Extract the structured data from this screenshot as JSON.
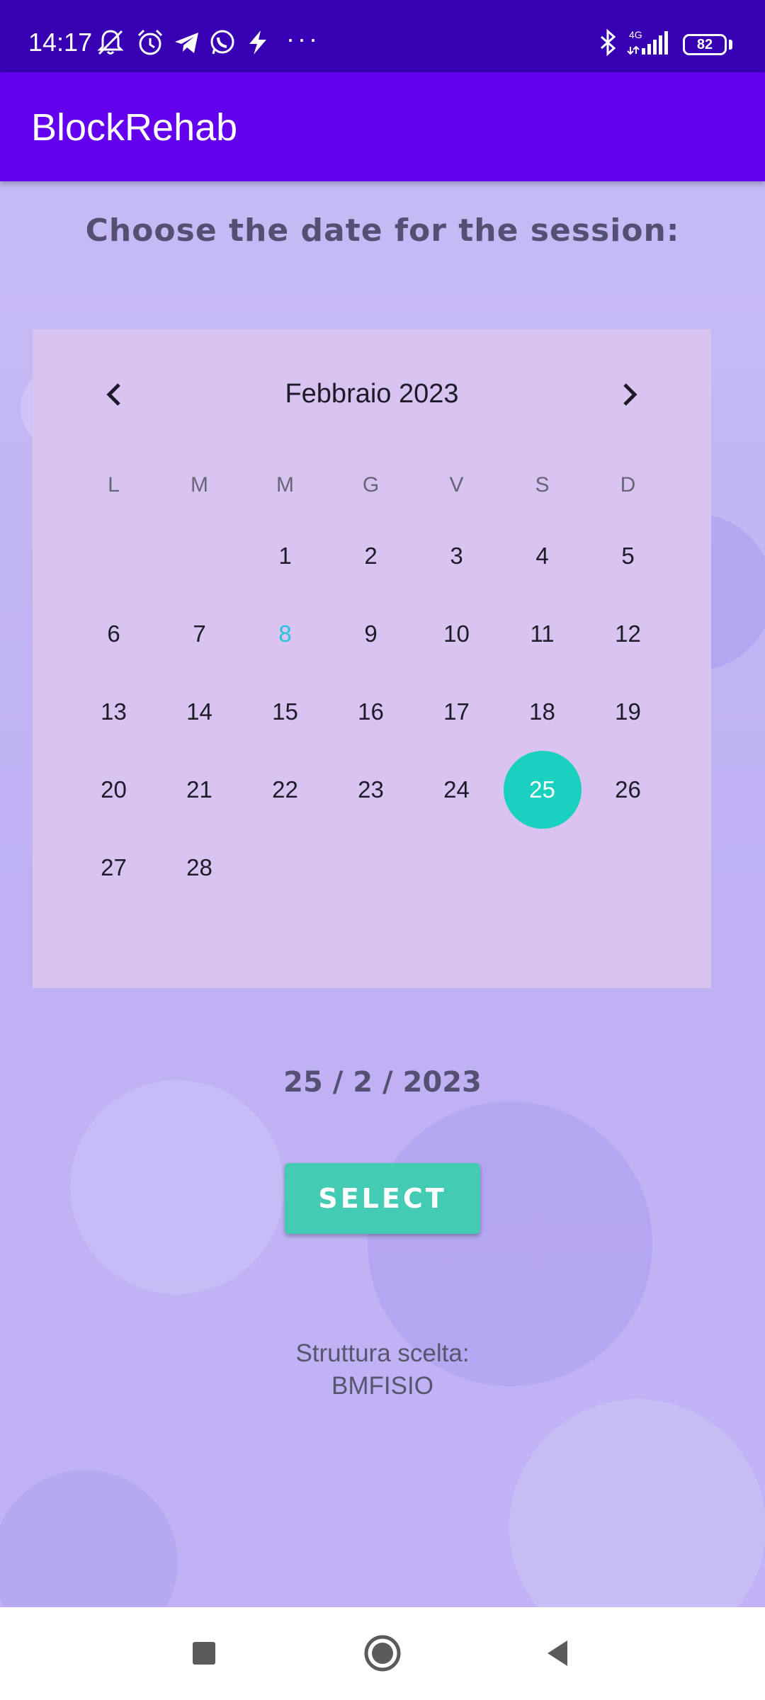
{
  "status_bar": {
    "time": "14:17",
    "network": "4G",
    "battery": "82",
    "more": "···"
  },
  "app_bar": {
    "title": "BlockRehab"
  },
  "heading": "Choose the date for the session:",
  "calendar": {
    "month_label": "Febbraio 2023",
    "weekdays": [
      "L",
      "M",
      "M",
      "G",
      "V",
      "S",
      "D"
    ],
    "leading_blanks": 2,
    "days": [
      "1",
      "2",
      "3",
      "4",
      "5",
      "6",
      "7",
      "8",
      "9",
      "10",
      "11",
      "12",
      "13",
      "14",
      "15",
      "16",
      "17",
      "18",
      "19",
      "20",
      "21",
      "22",
      "23",
      "24",
      "25",
      "26",
      "27",
      "28"
    ],
    "today": "8",
    "selected": "25",
    "today_color": "#26c6da",
    "selected_color": "#1ad1c0"
  },
  "selected_date": "25 / 2 / 2023",
  "select_button": {
    "label": "SELECT"
  },
  "struttura": {
    "label": "Struttura scelta:",
    "value": "BMFISIO"
  },
  "colors": {
    "status_bar": "#3700b3",
    "app_bar": "#6200ee",
    "accent": "#43cbb3"
  }
}
